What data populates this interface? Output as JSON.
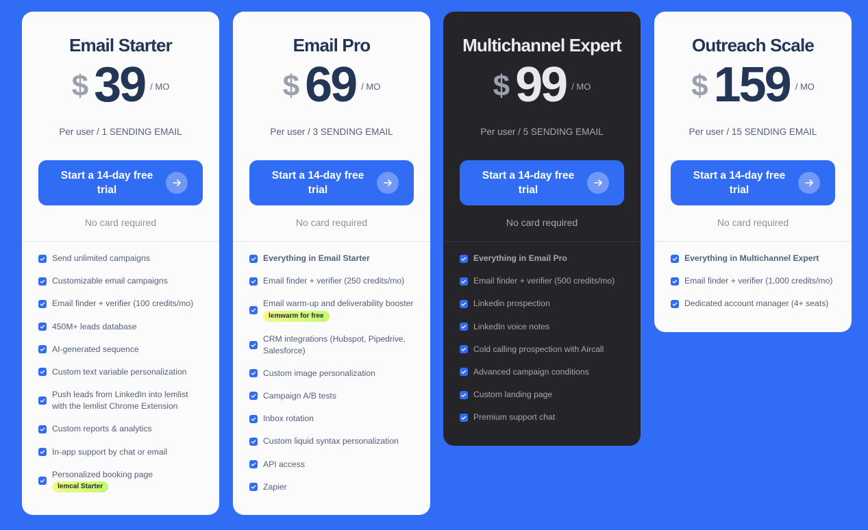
{
  "colors": {
    "background": "#316cf4",
    "accent": "#316cf4",
    "card_light": "#fbfbfc",
    "card_dark": "#252429",
    "title_text": "#233655",
    "badge_gradient": [
      "#f5f98a",
      "#c4fa6e"
    ]
  },
  "plans": [
    {
      "name": "Email Starter",
      "currency": "$",
      "price": "39",
      "period": "/ MO",
      "subline": "Per user / 1 SENDING EMAIL",
      "cta_label": "Start a 14-day free trial",
      "cta_icon": "arrow-right-icon",
      "note": "No card required",
      "features": [
        {
          "text": "Send unlimited campaigns"
        },
        {
          "text": "Customizable email campaigns"
        },
        {
          "text": "Email finder + verifier (100 credits/mo)"
        },
        {
          "text": "450M+ leads database"
        },
        {
          "text": "AI-generated sequence"
        },
        {
          "text": "Custom text variable personalization"
        },
        {
          "text": "Push leads from LinkedIn into lemlist with the lemlist Chrome Extension"
        },
        {
          "text": "Custom reports & analytics"
        },
        {
          "text": "In-app support by chat or email"
        },
        {
          "text": "Personalized booking page",
          "badge": "lemcal Starter"
        }
      ]
    },
    {
      "name": "Email Pro",
      "currency": "$",
      "price": "69",
      "period": "/ MO",
      "subline": "Per user / 3 SENDING EMAIL",
      "cta_label": "Start a 14-day free trial",
      "cta_icon": "arrow-right-icon",
      "note": "No card required",
      "features": [
        {
          "text": "Everything in Email Starter",
          "bold": true
        },
        {
          "text": "Email finder + verifier (250 credits/mo)"
        },
        {
          "text": "Email warm-up and deliverability booster",
          "badge": "lemwarm for free"
        },
        {
          "text": "CRM integrations (Hubspot, Pipedrive, Salesforce)"
        },
        {
          "text": "Custom image personalization"
        },
        {
          "text": "Campaign A/B tests"
        },
        {
          "text": "Inbox rotation"
        },
        {
          "text": "Custom liquid syntax personalization"
        },
        {
          "text": "API access"
        },
        {
          "text": "Zapier"
        }
      ]
    },
    {
      "name": "Multichannel Expert",
      "currency": "$",
      "price": "99",
      "period": "/ MO",
      "subline": "Per user / 5 SENDING EMAIL",
      "cta_label": "Start a 14-day free trial",
      "cta_icon": "arrow-right-icon",
      "note": "No card required",
      "dark": true,
      "features": [
        {
          "text": "Everything in Email Pro",
          "bold": true
        },
        {
          "text": "Email finder + verifier (500 credits/mo)"
        },
        {
          "text": "Linkedin prospection"
        },
        {
          "text": "LinkedIn voice notes"
        },
        {
          "text": "Cold calling prospection with Aircall"
        },
        {
          "text": "Advanced campaign conditions"
        },
        {
          "text": "Custom landing page"
        },
        {
          "text": "Premium support chat"
        }
      ]
    },
    {
      "name": "Outreach Scale",
      "currency": "$",
      "price": "159",
      "period": "/ MO",
      "subline": "Per user / 15 SENDING EMAIL",
      "cta_label": "Start a 14-day free trial",
      "cta_icon": "arrow-right-icon",
      "note": "No card required",
      "features": [
        {
          "text": "Everything in Multichannel Expert",
          "bold": true
        },
        {
          "text": "Email finder + verifier (1,000 credits/mo)"
        },
        {
          "text": "Dedicated account manager (4+ seats)"
        }
      ]
    }
  ]
}
